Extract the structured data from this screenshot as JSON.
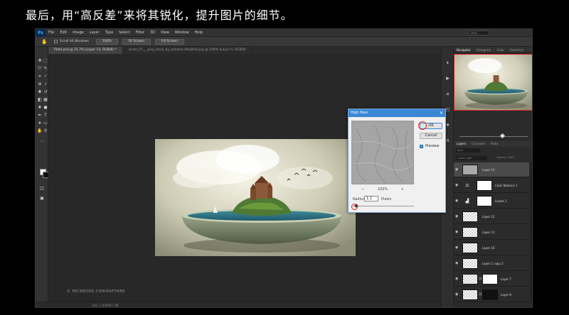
{
  "caption": "最后，用“高反差”来将其锐化，提升图片的细节。",
  "app": {
    "logo": "Ps",
    "menu": [
      "File",
      "Edit",
      "Image",
      "Layer",
      "Type",
      "Select",
      "Filter",
      "3D",
      "View",
      "Window",
      "Help"
    ],
    "search_placeholder": "rafya"
  },
  "options": {
    "scroll_all_label": "Scroll All Windows",
    "zoom_100": "100%",
    "fit_screen": "Fit Screen",
    "fill_screen": "Fill Screen"
  },
  "tabs": [
    {
      "label": "Plate.psd @ 31.7% (Layer 13, RGB/8) *",
      "active": true
    },
    {
      "label": "lands_07___png_stock_by_adastra-d9ej8s9.png @ 100% (Layer 0, RGB/8)",
      "active": false
    }
  ],
  "watermark": "© FACEBOOK.COM/RAFYA88",
  "status": "Doc: 7.44M/97.3M",
  "navigator": {
    "tabs": [
      "Navigator",
      "Histogram",
      "Color",
      "Swatches"
    ]
  },
  "layers": {
    "tabs": [
      "Layers",
      "Channels",
      "Paths"
    ],
    "filter_label": "Kind",
    "blend_mode": "Linear Light",
    "opacity_label": "Opacity: 100%",
    "rows": [
      {
        "name": "Layer 13",
        "type": "pixel",
        "selected": true
      },
      {
        "name": "Color Balance 1",
        "type": "adjustment",
        "selected": false
      },
      {
        "name": "Levels 1",
        "type": "adjustment",
        "selected": false
      },
      {
        "name": "Layer 12",
        "type": "pixel",
        "selected": false
      },
      {
        "name": "Layer 11",
        "type": "pixel",
        "selected": false
      },
      {
        "name": "Layer 10",
        "type": "pixel",
        "selected": false
      },
      {
        "name": "Layer 1 copy 2",
        "type": "pixel",
        "selected": false
      },
      {
        "name": "Layer 7",
        "type": "masked",
        "selected": false
      },
      {
        "name": "Layer 6",
        "type": "masked",
        "selected": false
      }
    ]
  },
  "dialog": {
    "title": "High Pass",
    "ok_label": "OK",
    "cancel_label": "Cancel",
    "preview_label": "Preview",
    "zoom_minus": "−",
    "zoom_level": "100%",
    "zoom_plus": "+",
    "radius_label": "Radius:",
    "radius_value": "1.2",
    "radius_unit": "Pixels"
  }
}
